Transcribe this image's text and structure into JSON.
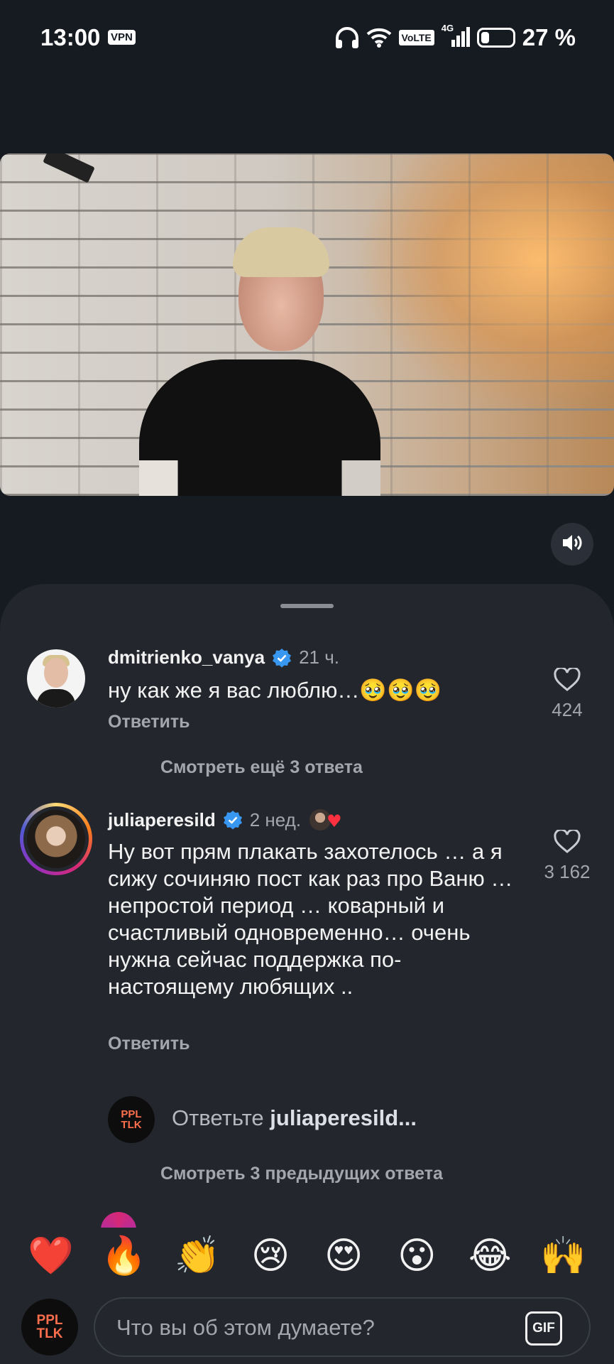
{
  "status_bar": {
    "time": "13:00",
    "vpn_label": "VPN",
    "volte_label": "VoLTE",
    "network_label": "4G",
    "battery_percent": "27 %",
    "battery_level": 0.27
  },
  "video": {
    "sound_icon": "speaker-icon"
  },
  "comments": [
    {
      "username": "dmitrienko_vanya",
      "verified": true,
      "time": "21 ч.",
      "text": "ну как же я вас люблю…🥹🥹🥹",
      "reply_label": "Ответить",
      "likes": "424",
      "more_replies": "Смотреть ещё 3 ответа"
    },
    {
      "username": "juliaperesild",
      "verified": true,
      "time": "2 нед.",
      "text": "Ну вот прям плакать захотелось … а я сижу сочиняю пост как раз про Ваню … непростой период … коварный и счастливый одновременно… очень нужна сейчас поддержка по- настоящему любящих ..",
      "reply_label": "Ответить",
      "likes": "3 162"
    }
  ],
  "reply_prompt": {
    "avatar_text_top": "PPL",
    "avatar_text_bottom": "TLK",
    "prefix": "Ответьте ",
    "target": "juliaperesild..."
  },
  "previous_replies": "Смотреть 3 предыдущих ответа",
  "emoji_bar": [
    "❤️",
    "🔥",
    "👏",
    "😢",
    "😍",
    "😮",
    "😂",
    "🙌"
  ],
  "input": {
    "avatar_text_top": "PPL",
    "avatar_text_bottom": "TLK",
    "placeholder": "Что вы об этом думаете?",
    "gif_label": "GIF"
  },
  "colors": {
    "background": "#161b22",
    "sheet": "#23262c",
    "secondary_text": "#a3a6ab",
    "verified": "#3897f0",
    "brand_ppl": "#ff6f4e"
  }
}
